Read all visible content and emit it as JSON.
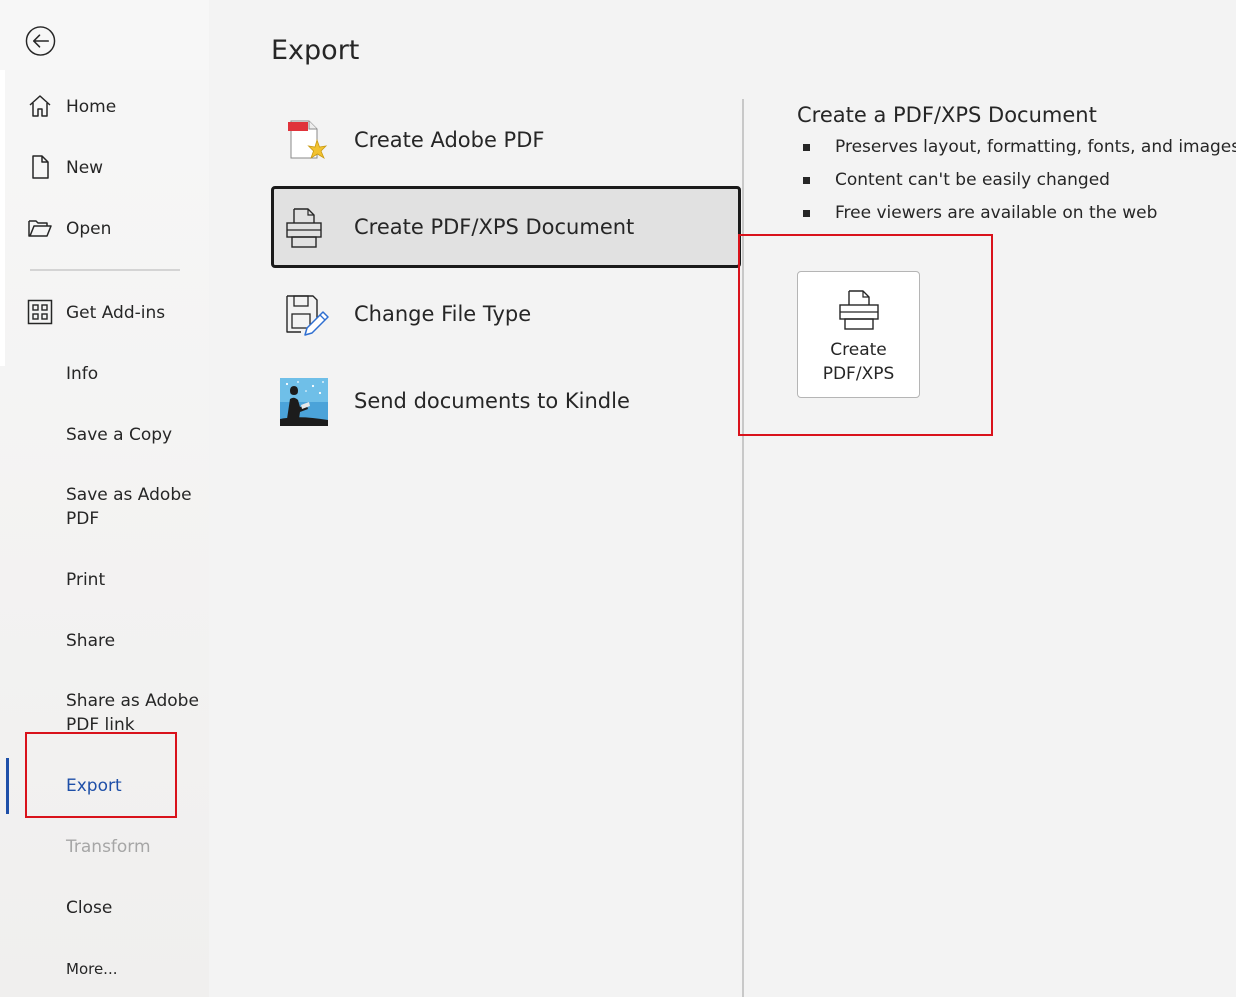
{
  "sidebar": {
    "back_icon": "back-arrow-icon",
    "items": [
      {
        "key": "home",
        "label": "Home",
        "icon": "home-icon"
      },
      {
        "key": "new",
        "label": "New",
        "icon": "new-document-icon"
      },
      {
        "key": "open",
        "label": "Open",
        "icon": "open-folder-icon"
      },
      {
        "key": "get-add-ins",
        "label": "Get Add-ins",
        "icon": "add-ins-grid-icon"
      },
      {
        "key": "info",
        "label": "Info"
      },
      {
        "key": "save-a-copy",
        "label": "Save a Copy"
      },
      {
        "key": "save-as-adobe-pdf",
        "label": "Save as Adobe PDF"
      },
      {
        "key": "print",
        "label": "Print"
      },
      {
        "key": "share",
        "label": "Share"
      },
      {
        "key": "share-as-adobe-pdf-link",
        "label": "Share as Adobe PDF link"
      },
      {
        "key": "export",
        "label": "Export",
        "active": true
      },
      {
        "key": "transform",
        "label": "Transform",
        "disabled": true
      },
      {
        "key": "close",
        "label": "Close"
      },
      {
        "key": "more",
        "label": "More..."
      }
    ]
  },
  "main": {
    "title": "Export",
    "options": [
      {
        "label": "Create Adobe PDF",
        "icon": "adobe-pdf-icon"
      },
      {
        "label": "Create PDF/XPS Document",
        "icon": "pdf-xps-printer-icon",
        "selected": true
      },
      {
        "label": "Change File Type",
        "icon": "change-file-type-icon"
      },
      {
        "label": "Send documents to Kindle",
        "icon": "kindle-icon"
      }
    ],
    "detail": {
      "title": "Create a PDF/XPS Document",
      "bullets": [
        "Preserves layout, formatting, fonts, and images",
        "Content can't be easily changed",
        "Free viewers are available on the web"
      ],
      "button_label": "Create PDF/XPS",
      "button_icon": "pdf-xps-printer-icon"
    }
  },
  "colors": {
    "accent": "#1e4fa8",
    "highlight_box": "#d9121b",
    "disabled_text": "#a6a6a6"
  }
}
